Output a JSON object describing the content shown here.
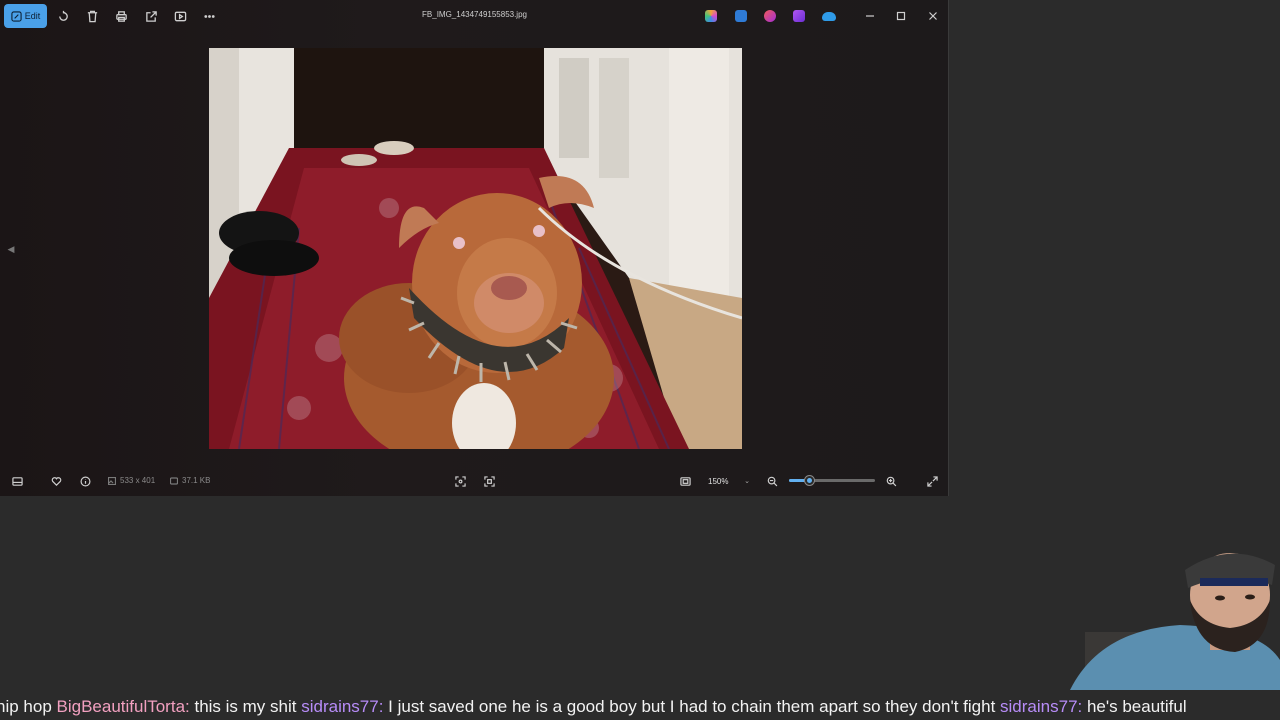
{
  "window": {
    "filename": "FB_IMG_1434749155853.jpg",
    "edit_label": "Edit"
  },
  "toolbar_icons": [
    "rotate-icon",
    "delete-icon",
    "print-icon",
    "share-icon",
    "slideshow-icon",
    "more-icon"
  ],
  "apps": [
    {
      "name": "copilot-app-icon",
      "color": "#c86dd7"
    },
    {
      "name": "designer-app-icon",
      "color": "#2f7bd6"
    },
    {
      "name": "clipchamp-app-icon",
      "color": "#d8379a"
    },
    {
      "name": "photos-app-icon",
      "color": "#8b3fd9"
    },
    {
      "name": "onedrive-app-icon",
      "color": "#2f9be8"
    }
  ],
  "info": {
    "dimensions": "533 x 401",
    "file_size": "37.1 KB"
  },
  "zoom": {
    "level": "150%",
    "slider_fraction": 0.23
  },
  "chat": {
    "segments": [
      {
        "text": "hip hop ",
        "kind": "msg"
      },
      {
        "text": "BigBeautifulTorta:",
        "kind": "user-pink"
      },
      {
        "text": " this is my shit ",
        "kind": "msg"
      },
      {
        "text": "sidrains77:",
        "kind": "user-purple"
      },
      {
        "text": " I just saved one he is a good boy but I had to chain them apart so they don't fight ",
        "kind": "msg"
      },
      {
        "text": "sidrains77:",
        "kind": "user-purple"
      },
      {
        "text": " he's beautiful",
        "kind": "msg"
      }
    ]
  },
  "colors": {
    "accent": "#4aa0e8",
    "window_bg": "#1d1a1b",
    "desktop_bg": "#2b2b2b"
  }
}
